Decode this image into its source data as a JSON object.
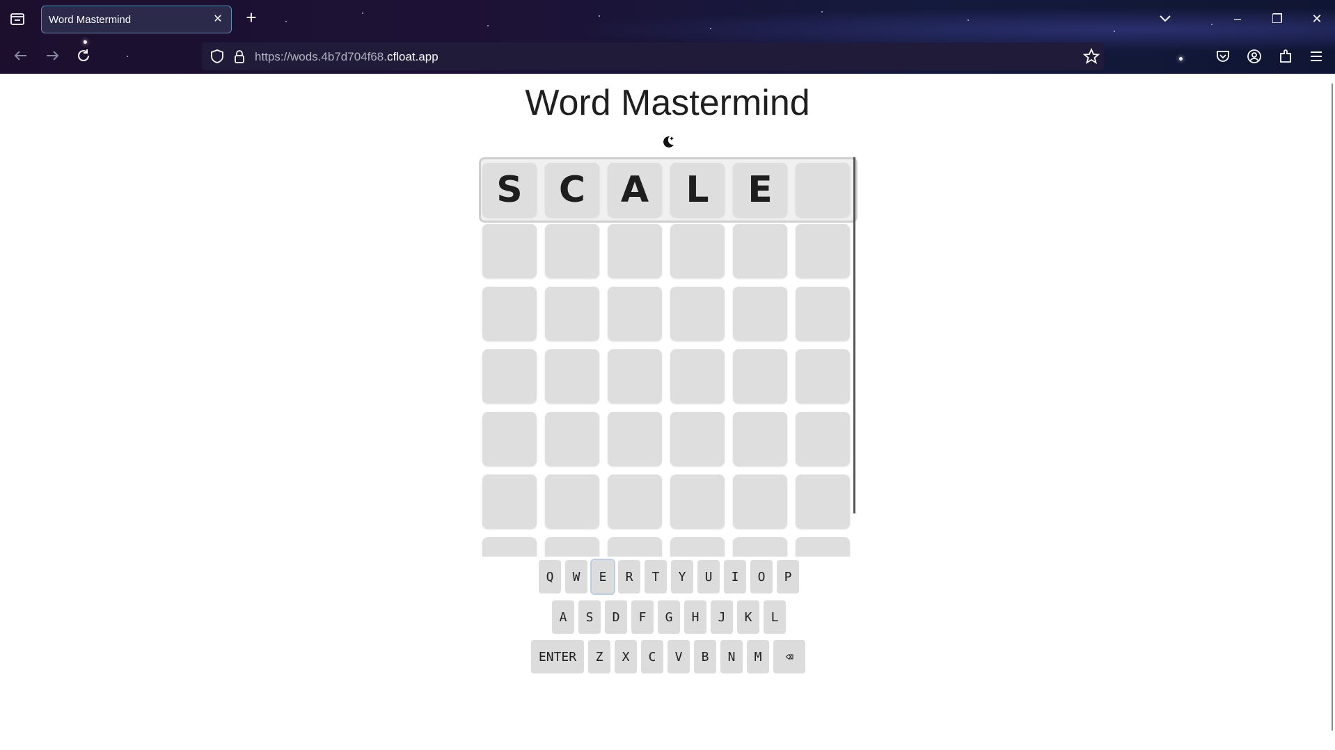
{
  "browser": {
    "tab_title": "Word Mastermind",
    "url_prefix": "https://wods.4b7d704f68.",
    "url_domain": "cfloat.app"
  },
  "page": {
    "title": "Word Mastermind",
    "theme_icon": "moon-stars-icon"
  },
  "board": {
    "columns": 6,
    "rows": [
      [
        "S",
        "C",
        "A",
        "L",
        "E",
        ""
      ],
      [
        "",
        "",
        "",
        "",
        "",
        ""
      ],
      [
        "",
        "",
        "",
        "",
        "",
        ""
      ],
      [
        "",
        "",
        "",
        "",
        "",
        ""
      ],
      [
        "",
        "",
        "",
        "",
        "",
        ""
      ],
      [
        "",
        "",
        "",
        "",
        "",
        ""
      ],
      [
        "",
        "",
        "",
        "",
        "",
        ""
      ]
    ],
    "active_row": 0
  },
  "keyboard": {
    "rows": [
      [
        "Q",
        "W",
        "E",
        "R",
        "T",
        "Y",
        "U",
        "I",
        "O",
        "P"
      ],
      [
        "A",
        "S",
        "D",
        "F",
        "G",
        "H",
        "J",
        "K",
        "L"
      ],
      [
        "ENTER",
        "Z",
        "X",
        "C",
        "V",
        "B",
        "N",
        "M",
        "⌫"
      ]
    ],
    "focused_key": "E"
  }
}
